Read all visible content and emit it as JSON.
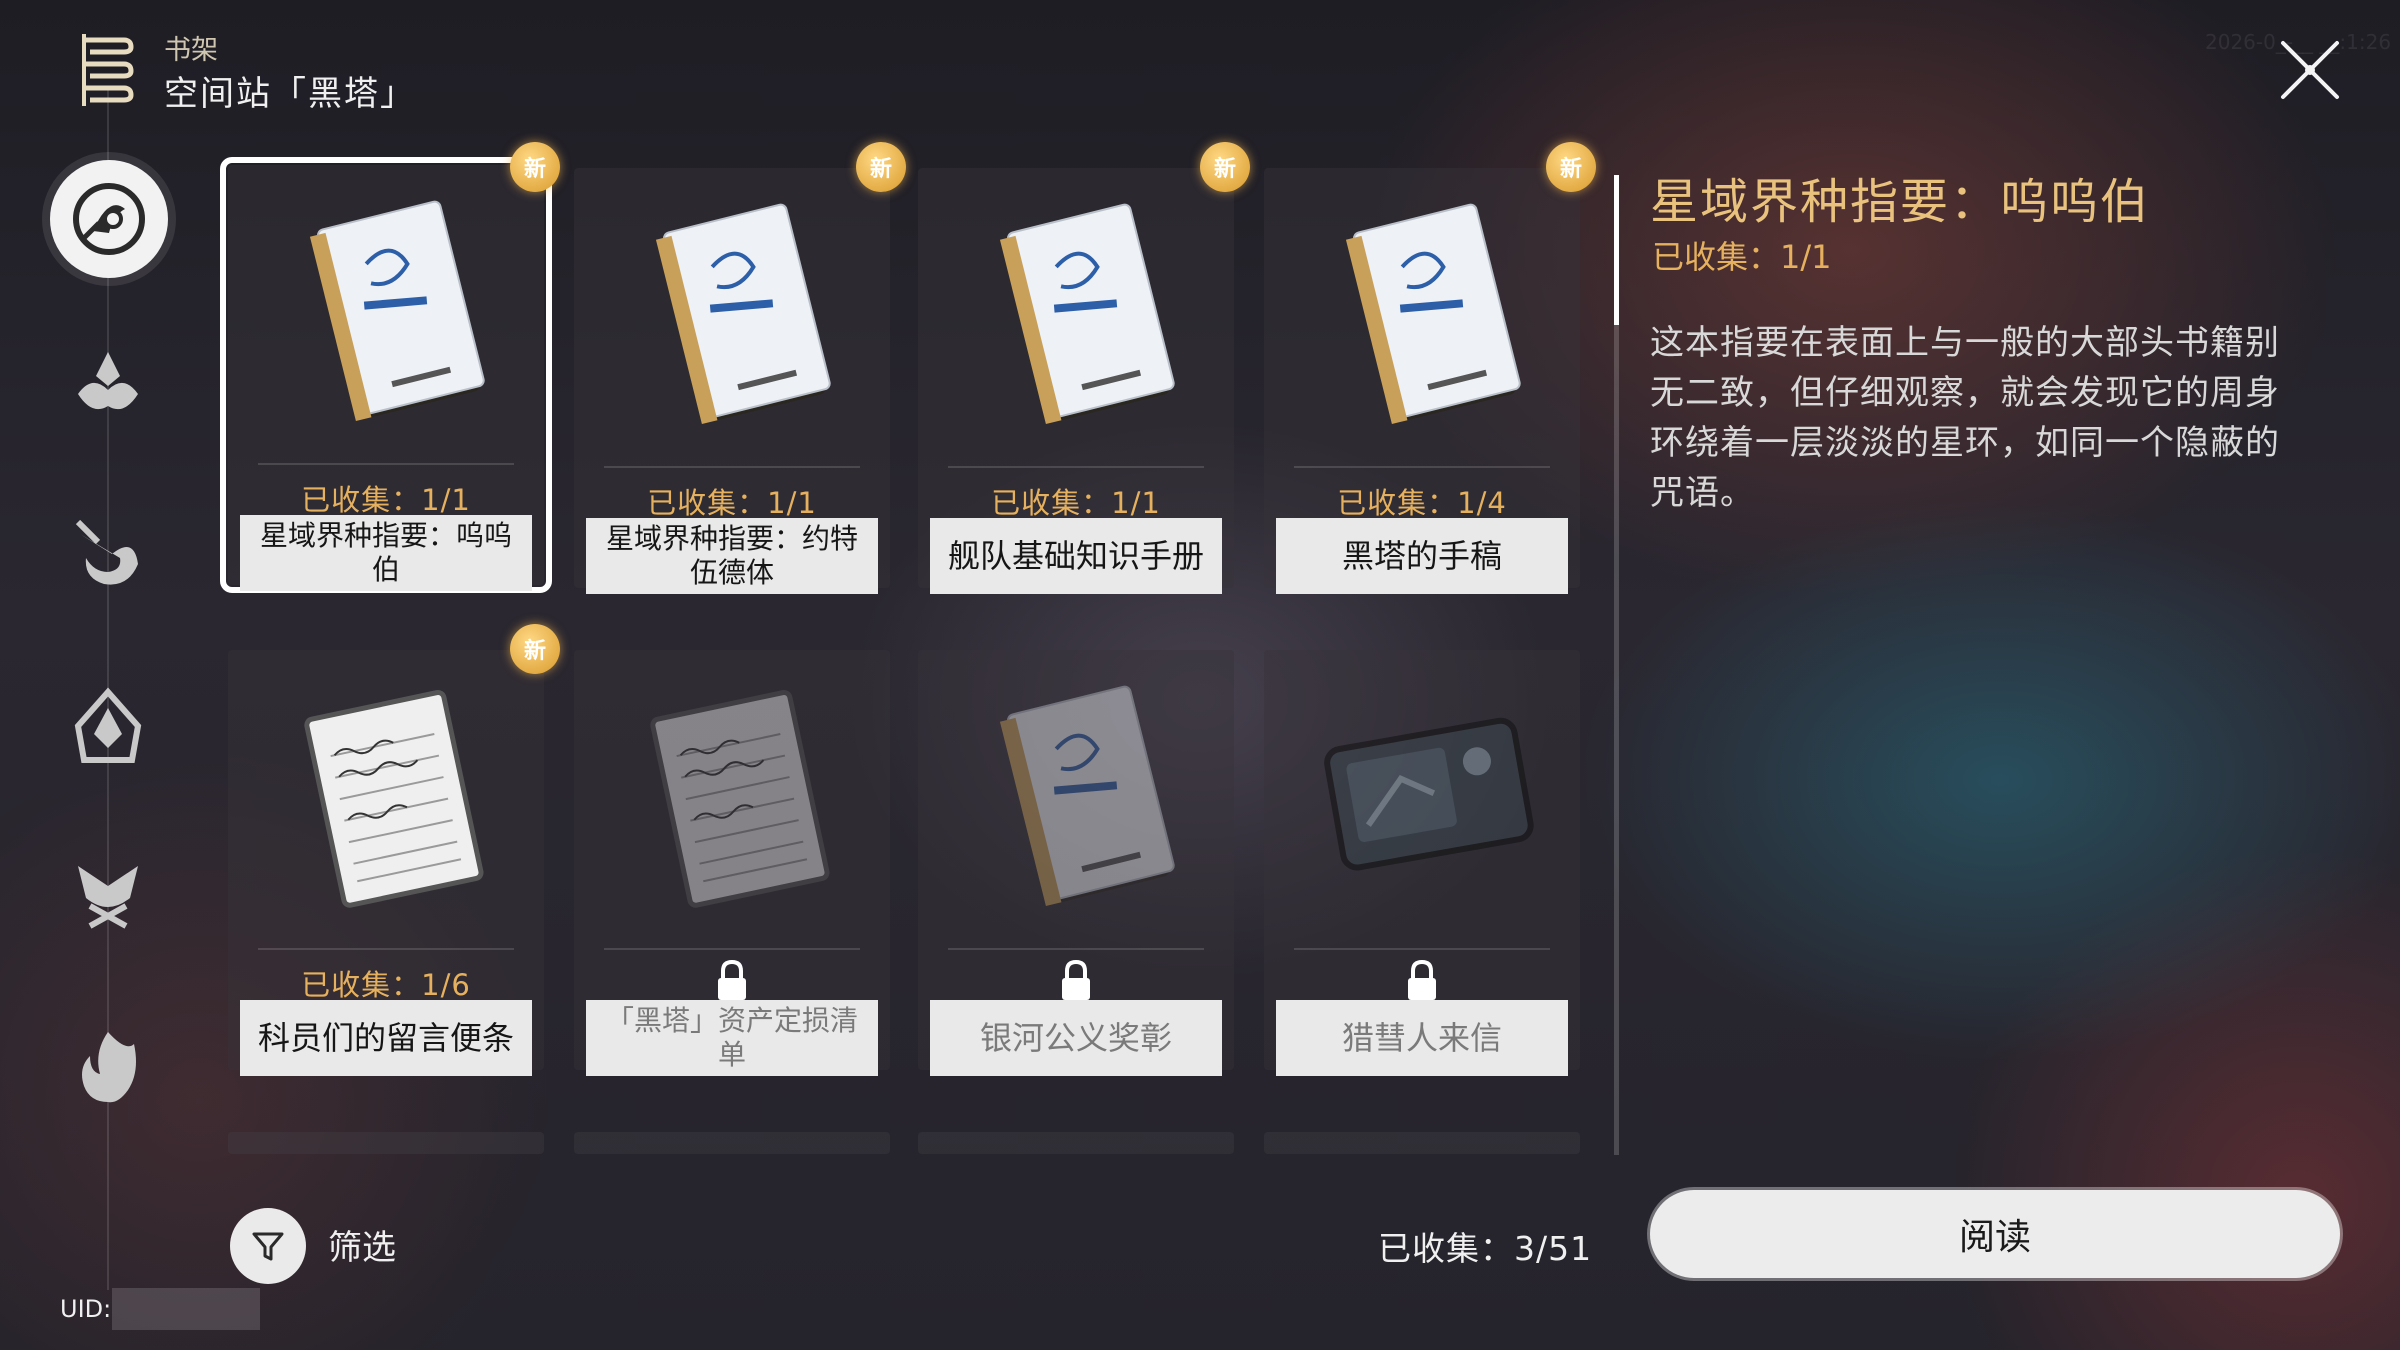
{
  "header": {
    "subtitle": "书架",
    "title": "空间站「黑塔」",
    "timestamp": "2026-0_-__ __:1:26"
  },
  "side_nav": [
    {
      "icon": "herta-station-emblem-icon",
      "active": true
    },
    {
      "icon": "lotus-crystal-icon",
      "active": false
    },
    {
      "icon": "dragon-emblem-icon",
      "active": false
    },
    {
      "icon": "belobog-emblem-icon",
      "active": false
    },
    {
      "icon": "fox-emblem-icon",
      "active": false
    },
    {
      "icon": "flame-emblem-icon",
      "active": false
    }
  ],
  "books": [
    {
      "title": "星域界种指要：呜呜伯",
      "count": "已收集：1/1",
      "locked": false,
      "is_new": true,
      "selected": true
    },
    {
      "title": "星域界种指要：约特伍德体",
      "count": "已收集：1/1",
      "locked": false,
      "is_new": true,
      "selected": false
    },
    {
      "title": "舰队基础知识手册",
      "count": "已收集：1/1",
      "locked": false,
      "is_new": true,
      "selected": false
    },
    {
      "title": "黑塔的手稿",
      "count": "已收集：1/4",
      "locked": false,
      "is_new": true,
      "selected": false
    },
    {
      "title": "科员们的留言便条",
      "count": "已收集：1/6",
      "locked": false,
      "is_new": true,
      "selected": false
    },
    {
      "title": "「黑塔」资产定损清单",
      "count": "",
      "locked": true,
      "is_new": false,
      "selected": false
    },
    {
      "title": "银河公义奖彰",
      "count": "",
      "locked": true,
      "is_new": false,
      "selected": false
    },
    {
      "title": "猎彗人来信",
      "count": "",
      "locked": true,
      "is_new": false,
      "selected": false
    }
  ],
  "new_badge": "新",
  "detail": {
    "title": "星域界种指要：呜呜伯",
    "count": "已收集：1/1",
    "description": "这本指要在表面上与一般的大部头书籍别无二致，但仔细观察，就会发现它的周身环绕着一层淡淡的星环，如同一个隐蔽的咒语。"
  },
  "footer": {
    "filter_label": "筛选",
    "collected_total": "已收集：3/51",
    "read_button": "阅读",
    "uid_label": "UID:"
  },
  "colors": {
    "accent_gold": "#e6b15e",
    "title_gold": "#e9c27e",
    "label_bg": "#e9e9e9",
    "new_badge": "#f0b23c"
  }
}
